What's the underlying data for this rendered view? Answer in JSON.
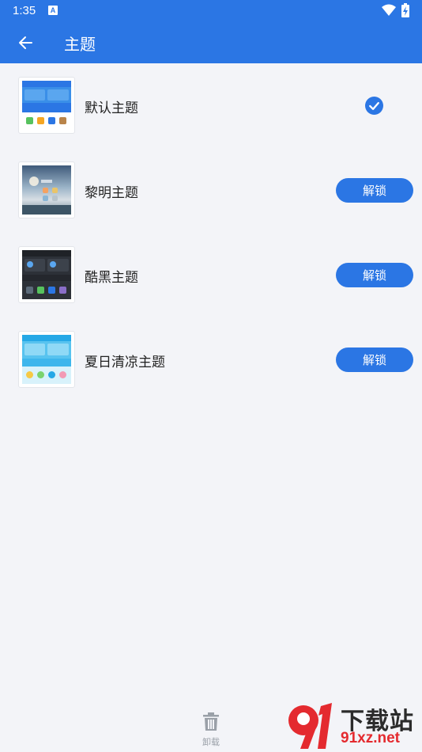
{
  "status_bar": {
    "time": "1:35",
    "notification_letter": "A"
  },
  "app_bar": {
    "title": "主题"
  },
  "themes": [
    {
      "name": "默认主题",
      "state": "selected"
    },
    {
      "name": "黎明主题",
      "action_label": "解锁"
    },
    {
      "name": "酷黑主题",
      "action_label": "解锁"
    },
    {
      "name": "夏日清凉主题",
      "action_label": "解锁"
    }
  ],
  "bottom": {
    "uninstall_label": "卸载"
  },
  "watermark": {
    "brand": "下载站",
    "url": "91xz.net"
  },
  "colors": {
    "primary": "#2b76e4",
    "background": "#f3f4f8",
    "watermark_red": "#e42a2f"
  }
}
